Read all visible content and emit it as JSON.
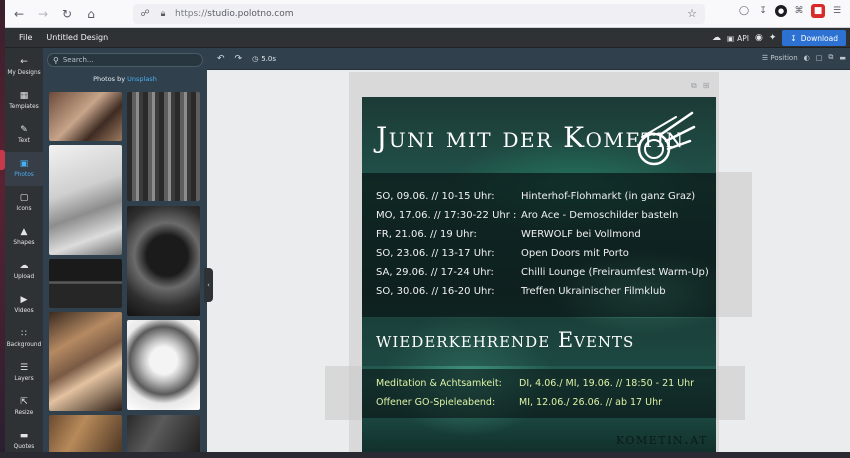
{
  "browser": {
    "url_protocol": "https://",
    "url_host": "studio.polotno.com"
  },
  "app": {
    "file_menu": "File",
    "design_title": "Untitled Design",
    "api_label": "API",
    "download_label": "Download"
  },
  "side_tabs": [
    {
      "label": "My Designs",
      "icon": "folder-icon"
    },
    {
      "label": "Templates",
      "icon": "templates-icon"
    },
    {
      "label": "Text",
      "icon": "text-icon"
    },
    {
      "label": "Photos",
      "icon": "photos-icon"
    },
    {
      "label": "Icons",
      "icon": "icons-icon"
    },
    {
      "label": "Shapes",
      "icon": "shapes-icon"
    },
    {
      "label": "Upload",
      "icon": "upload-icon"
    },
    {
      "label": "Videos",
      "icon": "videos-icon"
    },
    {
      "label": "Background",
      "icon": "background-icon"
    },
    {
      "label": "Layers",
      "icon": "layers-icon"
    },
    {
      "label": "Resize",
      "icon": "resize-icon"
    },
    {
      "label": "Quotes",
      "icon": "quotes-icon"
    }
  ],
  "panel": {
    "search_placeholder": "Search...",
    "photos_by": "Photos by",
    "photos_source": "Unsplash"
  },
  "toolbar": {
    "duration": "5.0s",
    "position_label": "Position"
  },
  "poster": {
    "title": "Juni mit der Kometin",
    "events": [
      {
        "date": "SO, 09.06. // 10-15 Uhr:",
        "name": "Hinterhof-Flohmarkt (in ganz Graz)"
      },
      {
        "date": "MO, 17.06. // 17:30-22 Uhr :",
        "name": "Aro Ace - Demoschilder basteln"
      },
      {
        "date": "FR, 21.06. // 19 Uhr:",
        "name": "WERWOLF bei Vollmond"
      },
      {
        "date": "SO, 23.06. // 13-17 Uhr:",
        "name": "Open Doors mit Porto"
      },
      {
        "date": "SA, 29.06. // 17-24 Uhr:",
        "name": "Chilli Lounge (Freiraumfest Warm-Up)"
      },
      {
        "date": "SO, 30.06. // 16-20 Uhr:",
        "name": "Treffen Ukrainischer Filmklub"
      }
    ],
    "recurring_title": "wiederkehrende Events",
    "recurring": [
      {
        "label": "Meditation & Achtsamkeit:",
        "when": "DI, 4.06./ MI, 19.06. // 18:50 - 21 Uhr"
      },
      {
        "label": "Offener GO-Spieleabend:",
        "when": "MI, 12.06./ 26.06. // ab 17 Uhr"
      }
    ],
    "site": "kometin.at"
  },
  "colors": {
    "accent": "#48aff0",
    "download": "#2d72d2",
    "recurring_text": "#dff3a6"
  }
}
